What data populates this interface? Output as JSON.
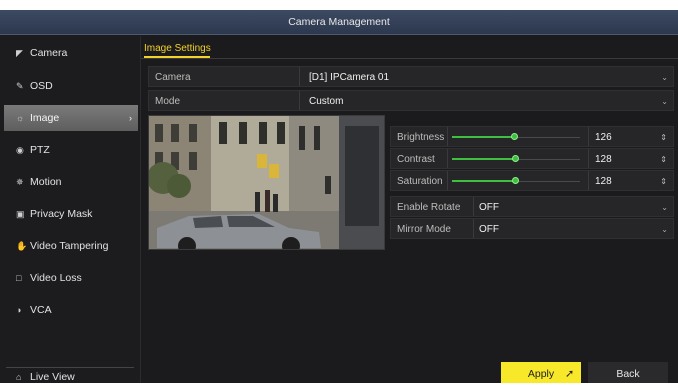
{
  "window": {
    "title": "Camera Management"
  },
  "sidebar": {
    "items": [
      {
        "label": "Camera",
        "icon": "camera-icon"
      },
      {
        "label": "OSD",
        "icon": "osd-icon"
      },
      {
        "label": "Image",
        "icon": "image-icon",
        "active": true
      },
      {
        "label": "PTZ",
        "icon": "ptz-icon"
      },
      {
        "label": "Motion",
        "icon": "motion-icon"
      },
      {
        "label": "Privacy Mask",
        "icon": "privacy-mask-icon"
      },
      {
        "label": "Video Tampering",
        "icon": "video-tampering-icon"
      },
      {
        "label": "Video Loss",
        "icon": "video-loss-icon"
      },
      {
        "label": "VCA",
        "icon": "vca-icon"
      }
    ],
    "live_view": {
      "label": "Live View",
      "icon": "home-icon"
    }
  },
  "tab": {
    "label": "Image Settings"
  },
  "form": {
    "camera": {
      "label": "Camera",
      "value": "[D1] IPCamera 01"
    },
    "mode": {
      "label": "Mode",
      "value": "Custom"
    }
  },
  "adjustments": [
    {
      "label": "Brightness",
      "value": "126",
      "level": 0.49
    },
    {
      "label": "Contrast",
      "value": "128",
      "level": 0.5
    },
    {
      "label": "Saturation",
      "value": "128",
      "level": 0.5
    }
  ],
  "options": {
    "enable_rotate": {
      "label": "Enable Rotate",
      "value": "OFF"
    },
    "mirror_mode": {
      "label": "Mirror Mode",
      "value": "OFF"
    }
  },
  "buttons": {
    "apply": "Apply",
    "back": "Back"
  },
  "colors": {
    "accent": "#f4d22a",
    "slider": "#3fbf3f",
    "apply_bg": "#f7e82a",
    "titlebar": "#34415a"
  }
}
